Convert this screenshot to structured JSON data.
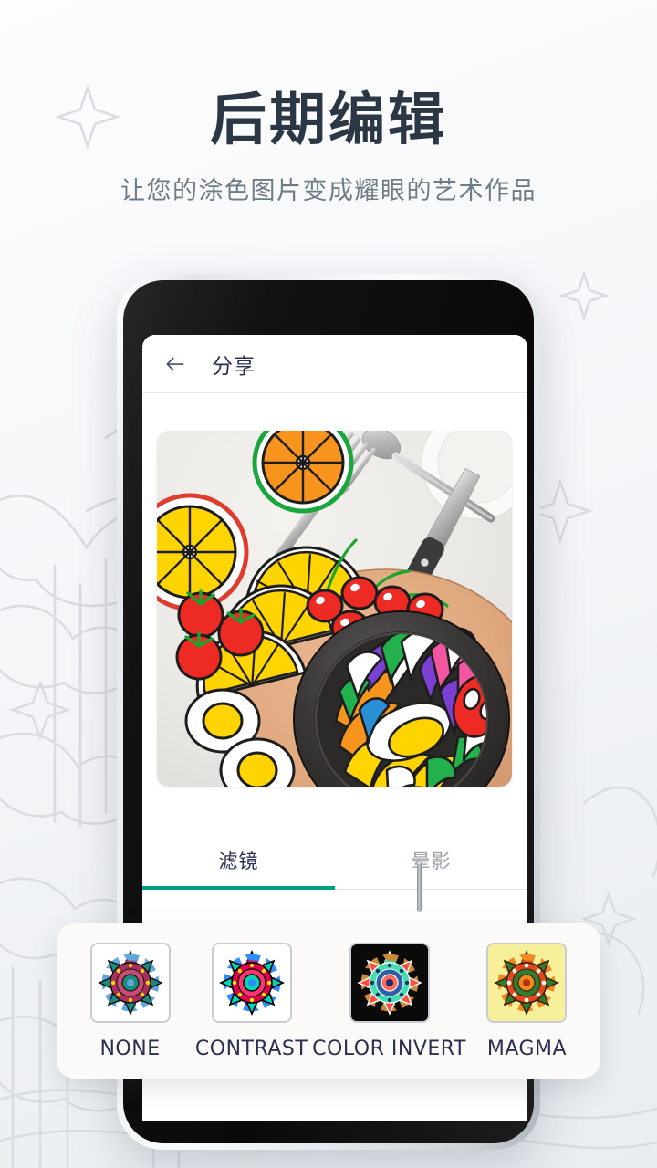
{
  "promo": {
    "title": "后期编辑",
    "subtitle": "让您的涂色图片变成耀眼的艺术作品"
  },
  "phone": {
    "appbar": {
      "back_icon": "arrow-left-icon",
      "title": "分享"
    },
    "preview": {
      "description": "涂色完成的美食照片预览：橙子片、柠檬片、樱桃、番茄、水煮蛋与黑色沙拉碗"
    },
    "tabs": [
      {
        "label": "滤镜",
        "active": true
      },
      {
        "label": "晕影",
        "active": false
      }
    ],
    "accent_color": "#00a085"
  },
  "filters": [
    {
      "label": "NONE",
      "background": "#ffffff",
      "selected": true
    },
    {
      "label": "CONTRAST",
      "background": "#ffffff",
      "selected": false
    },
    {
      "label": "COLOR INVERT",
      "background": "#0a0a0a",
      "selected": false
    },
    {
      "label": "MAGMA",
      "background": "#f7f09a",
      "selected": false
    }
  ]
}
